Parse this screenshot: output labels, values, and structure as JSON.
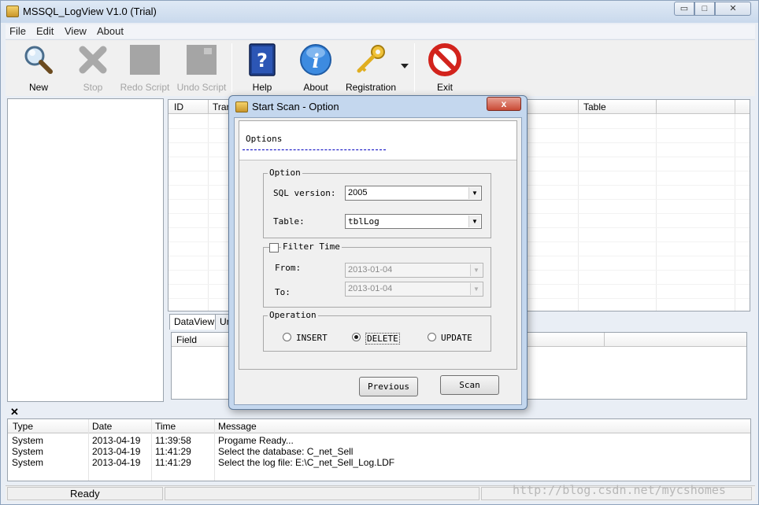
{
  "window": {
    "title": "MSSQL_LogView V1.0 (Trial)",
    "min": "▭",
    "max": "□",
    "close": "✕"
  },
  "menu": [
    "File",
    "Edit",
    "View",
    "About"
  ],
  "toolbar": {
    "new": "New",
    "stop": "Stop",
    "redo": "Redo Script",
    "undo": "Undo Script",
    "help": "Help",
    "about": "About",
    "registration": "Registration",
    "exit": "Exit"
  },
  "grid": {
    "columns": [
      "ID",
      "Tran",
      "Table"
    ]
  },
  "tabs": {
    "dataview": "DataView",
    "other": "Un"
  },
  "fieldgrid": {
    "columns": [
      "Field"
    ]
  },
  "log": {
    "close": "✕",
    "columns": [
      "Type",
      "Date",
      "Time",
      "Message"
    ],
    "rows": [
      {
        "type": "System",
        "date": "2013-04-19",
        "time": "11:39:58",
        "message": "Progame Ready..."
      },
      {
        "type": "System",
        "date": "2013-04-19",
        "time": "11:41:29",
        "message": "Select the database: C_net_Sell"
      },
      {
        "type": "System",
        "date": "2013-04-19",
        "time": "11:41:29",
        "message": "Select the log file: E:\\C_net_Sell_Log.LDF"
      }
    ]
  },
  "status": {
    "text": "Ready",
    "watermark": "http://blog.csdn.net/mycshomes"
  },
  "dialog": {
    "title": "Start Scan - Option",
    "close": "x",
    "options_title": "Options",
    "option_group": "Option",
    "sql_version_label": "SQL version:",
    "sql_version_value": "2005",
    "table_label": "Table:",
    "table_value": "tblLog",
    "filter_group": "Filter Time",
    "from_label": "From:",
    "from_value": "2013-01-04",
    "to_label": "To:",
    "to_value": "2013-01-04",
    "operation_group": "Operation",
    "op_insert": "INSERT",
    "op_delete": "DELETE",
    "op_update": "UPDATE",
    "selected_op": "DELETE",
    "previous": "Previous",
    "scan": "Scan"
  }
}
